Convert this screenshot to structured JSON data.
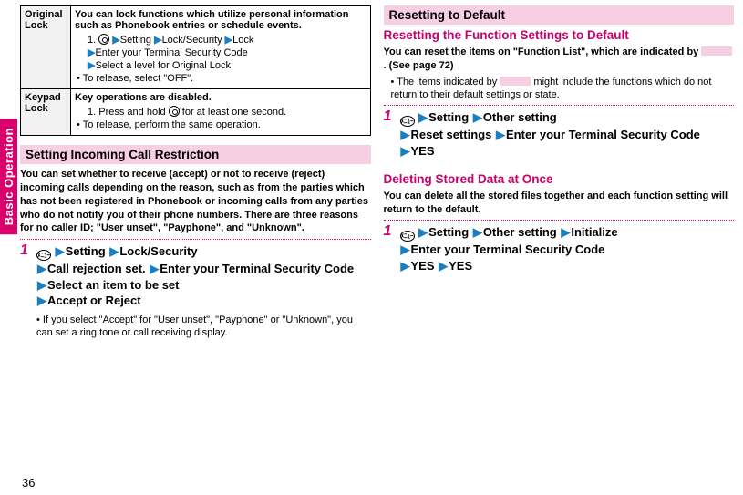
{
  "sideTab": "Basic Operation",
  "pageNumber": "36",
  "left": {
    "table": {
      "row1": {
        "label": "Original Lock",
        "desc": "You can lock functions which utilize personal information such as Phonebook entries or schedule events.",
        "stepPrefix": "1.",
        "s1a": "Setting",
        "s1b": "Lock/Security",
        "s1c": "Lock",
        "s2": "Enter your Terminal Security Code",
        "s3": "Select a level for Original Lock.",
        "release": "To release, select \"OFF\"."
      },
      "row2": {
        "label": "Keypad Lock",
        "desc": "Key operations are disabled.",
        "stepPrefix": "1.",
        "s1a": "Press and hold",
        "s1b": "for at least one second.",
        "release": "To release, perform the same operation."
      }
    },
    "heading": "Setting Incoming Call Restriction",
    "para": "You can set whether to receive (accept) or not to receive (reject) incoming calls depending on the reason, such as from the parties which has not been registered in Phonebook or incoming calls from any parties who do not notify you of their phone numbers. There are three reasons for no caller ID; \"User unset\", \"Payphone\", and \"Unknown\".",
    "step1": {
      "num": "1",
      "p1": "Setting",
      "p2": "Lock/Security",
      "p3": "Call rejection set.",
      "p4": "Enter your Terminal Security Code",
      "p5": "Select an item to be set",
      "p6": "Accept or Reject",
      "note": "If you select \"Accept\" for \"User unset\", \"Payphone\" or \"Unknown\", you can set a ring tone or call receiving display."
    }
  },
  "right": {
    "heading1": "Resetting to Default",
    "subheading1": "Resetting the Function Settings to Default",
    "para1a": "You can reset the items on \"Function List\", which are indicated by ",
    "para1b": ". (See page 72)",
    "note1a": "The items indicated by ",
    "note1b": " might include the functions which do not return to their default settings or state.",
    "step1": {
      "num": "1",
      "p1": "Setting",
      "p2": "Other setting",
      "p3": "Reset settings",
      "p4": "Enter your Terminal Security Code",
      "p5": "YES"
    },
    "subheading2": "Deleting Stored Data at Once",
    "para2": "You can delete all the stored files together and each function setting will return to the default.",
    "step2": {
      "num": "1",
      "p1": "Setting",
      "p2": "Other setting",
      "p3": "Initialize",
      "p4": "Enter your Terminal Security Code",
      "p5": "YES",
      "p6": "YES"
    }
  }
}
